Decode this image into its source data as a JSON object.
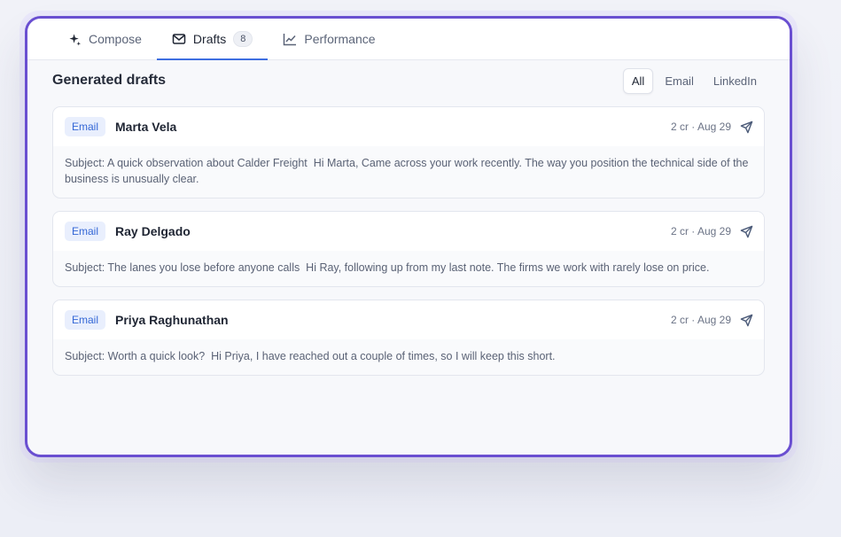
{
  "tabs": [
    {
      "label": "Compose",
      "icon": "sparkle-icon"
    },
    {
      "label": "Drafts",
      "icon": "mail-icon",
      "count": "8"
    },
    {
      "label": "Performance",
      "icon": "line-chart-icon"
    }
  ],
  "section": {
    "title": "Generated drafts"
  },
  "filters": [
    "All",
    "Email",
    "LinkedIn"
  ],
  "drafts": [
    {
      "channel": "Email",
      "name": "Marta Vela",
      "meta": "2 cr · Aug 29",
      "preview": "Subject: A quick observation about Calder Freight  Hi Marta, Came across your work recently. The way you position the technical side of the business is unusually clear."
    },
    {
      "channel": "Email",
      "name": "Ray Delgado",
      "meta": "2 cr · Aug 29",
      "preview": "Subject: The lanes you lose before anyone calls  Hi Ray, following up from my last note. The firms we work with rarely lose on price."
    },
    {
      "channel": "Email",
      "name": "Priya Raghunathan",
      "meta": "2 cr · Aug 29",
      "preview": "Subject: Worth a quick look?  Hi Priya, I have reached out a couple of times, so I will keep this short."
    }
  ],
  "colors": {
    "accent": "#3f6fe0",
    "frame": "#6a4fd1",
    "badge_bg": "#e9effd",
    "badge_text": "#3467d6"
  }
}
